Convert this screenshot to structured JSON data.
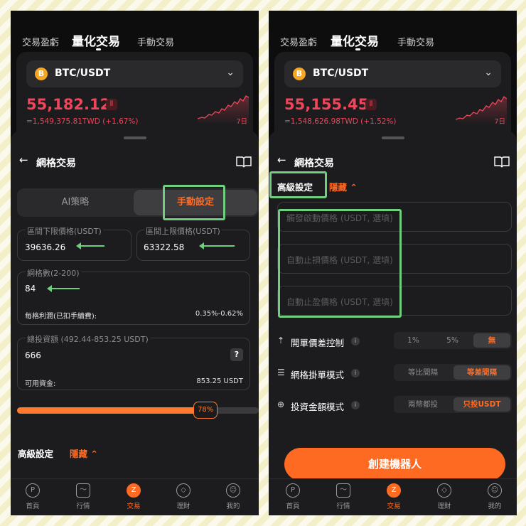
{
  "header_tabs": [
    "交易盈虧",
    "量化交易",
    "手動交易"
  ],
  "left": {
    "pair": "BTC/USDT",
    "coin_glyph": "B",
    "price": "55,182.12",
    "twd": "=1,549,375.81TWD (+1.67%)",
    "period": "7日",
    "sheet_title": "網格交易",
    "segments": [
      "AI策略",
      "手動設定"
    ],
    "lower_label": "區間下限價格(USDT)",
    "lower_value": "39636.26",
    "upper_label": "區間上限價格(USDT)",
    "upper_value": "63322.58",
    "grid_label": "網格數(2-200)",
    "grid_value": "84",
    "profit_label": "每格利潤(已扣手續費):",
    "profit_value": "0.35%-0.62%",
    "invest_label": "總投資額 (492.44-853.25 USDT)",
    "invest_value": "666",
    "help": "?",
    "avail_label": "可用資金:",
    "avail_value": "853.25 USDT",
    "progress_label": "78%",
    "progress_fraction": 0.78,
    "advanced": "高級設定",
    "hide": "隱藏"
  },
  "right": {
    "pair": "BTC/USDT",
    "coin_glyph": "B",
    "price": "55,155.45",
    "twd": "=1,548,626.98TWD (+1.52%)",
    "period": "7日",
    "sheet_title": "網格交易",
    "advanced": "高級設定",
    "hide": "隱藏",
    "placeholders": [
      "觸發啟動價格 (USDT, 選填)",
      "自動止損價格 (USDT, 選填)",
      "自動止盈價格 (USDT, 選填)"
    ],
    "option_rows": [
      {
        "label": "開單價差控制",
        "icon": "⇡",
        "options": [
          "1%",
          "5%",
          "無"
        ],
        "selected": 2
      },
      {
        "label": "網格掛單模式",
        "icon": "☰",
        "options": [
          "等比間隔",
          "等差間隔"
        ],
        "selected": 1
      },
      {
        "label": "投資金額模式",
        "icon": "⊕",
        "options": [
          "兩幣都投",
          "只投USDT"
        ],
        "selected": 1
      }
    ],
    "cta": "創建機器人"
  },
  "tabbar": [
    {
      "label": "首頁",
      "icon": "home-icon",
      "glyph": "P"
    },
    {
      "label": "行情",
      "icon": "chart-icon",
      "glyph": "〜"
    },
    {
      "label": "交易",
      "icon": "trade-icon",
      "glyph": "Z"
    },
    {
      "label": "理財",
      "icon": "diamond-icon",
      "glyph": "◇"
    },
    {
      "label": "我的",
      "icon": "profile-icon",
      "glyph": "☺"
    }
  ],
  "colors": {
    "accent": "#ff6a23",
    "down": "#f0455a",
    "highlight": "#6fcf7e"
  }
}
